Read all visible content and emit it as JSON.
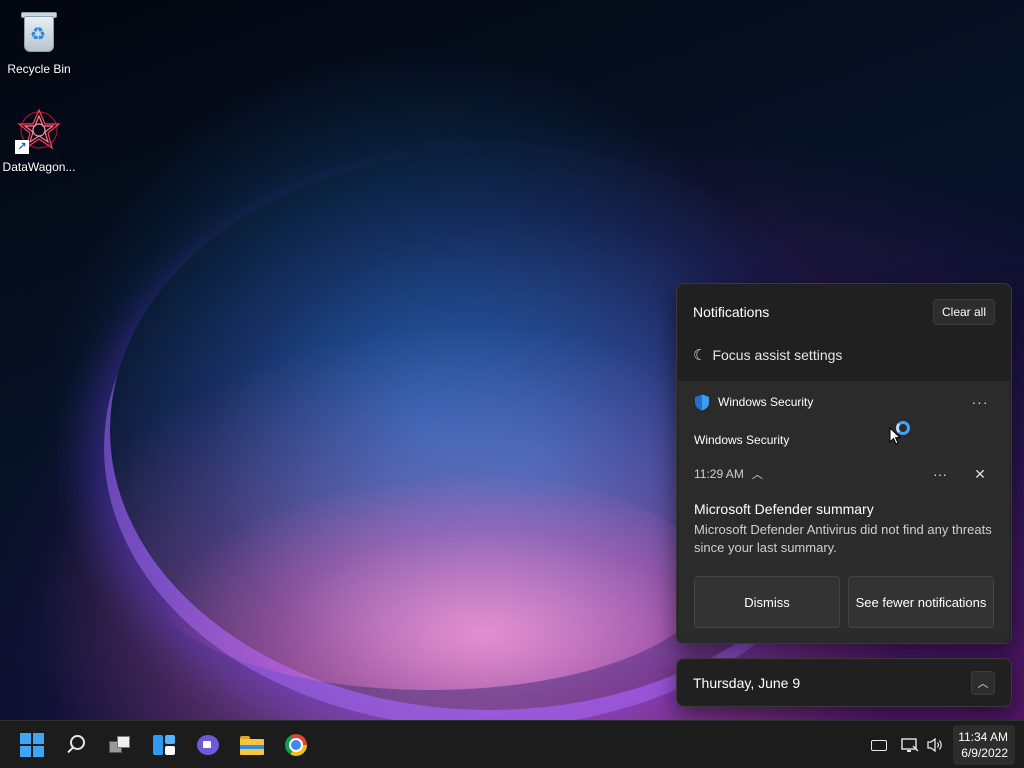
{
  "desktop": {
    "icons": [
      {
        "label": "Recycle Bin",
        "icon": "recycle-bin-icon"
      },
      {
        "label": "DataWagon...",
        "icon": "datawagon-app-icon",
        "shortcut": true
      }
    ]
  },
  "notifications": {
    "title": "Notifications",
    "clear_all_label": "Clear all",
    "focus_assist_label": "Focus assist settings",
    "card": {
      "app_name": "Windows Security",
      "source": "Windows Security",
      "time": "11:29 AM",
      "heading": "Microsoft Defender summary",
      "body": "Microsoft Defender Antivirus did not find any threats since your last summary.",
      "actions": {
        "dismiss": "Dismiss",
        "see_fewer": "See fewer notifications"
      }
    }
  },
  "calendar": {
    "date_label": "Thursday, June 9"
  },
  "taskbar": {
    "pinned": [
      "start-icon",
      "search-icon",
      "task-view-icon",
      "widgets-icon",
      "chat-icon",
      "file-explorer-icon",
      "chrome-icon"
    ],
    "tray": [
      "keyboard-icon",
      "network-icon",
      "volume-icon"
    ],
    "clock": {
      "time": "11:34 AM",
      "date": "6/9/2022"
    }
  },
  "colors": {
    "accent": "#3ea6f2",
    "panel_bg": "#202020",
    "card_bg": "#2b2b2b",
    "taskbar_bg": "#1c1c1c"
  }
}
